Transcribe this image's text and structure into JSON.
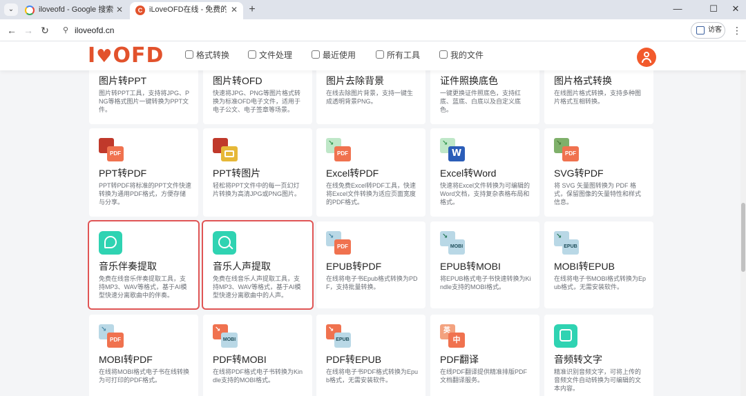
{
  "browser": {
    "tabs": [
      {
        "title": "iloveofd - Google 搜索",
        "favicon": "google-icon"
      },
      {
        "title": "iLoveOFD在线 - 免费的在线格",
        "favicon": "iloveofd-icon"
      }
    ],
    "url": "iloveofd.cn",
    "guest_label": "访客"
  },
  "header": {
    "logo": "I♥OFD",
    "nav": [
      {
        "label": "格式转换",
        "icon": "convert-icon"
      },
      {
        "label": "文件处理",
        "icon": "file-process-icon"
      },
      {
        "label": "最近使用",
        "icon": "recent-icon"
      },
      {
        "label": "所有工具",
        "icon": "all-tools-icon"
      },
      {
        "label": "我的文件",
        "icon": "my-files-icon"
      }
    ],
    "accent_color": "#e2522c"
  },
  "tools": [
    {
      "title": "图片转PPT",
      "desc": "图片转PPT工具，支持将JPG、PNG等格式图片一键转换为PPT文件。"
    },
    {
      "title": "图片转OFD",
      "desc": "快速将JPG、PNG等图片格式转换为标准OFD电子文件，适用于电子公文、电子签章等场景。"
    },
    {
      "title": "图片去除背景",
      "desc": "在线去除图片背景，支持一键生成透明背景PNG。"
    },
    {
      "title": "证件照换底色",
      "desc": "一键更换证件照底色，支持红底、蓝底、白底以及自定义底色。"
    },
    {
      "title": "图片格式转换",
      "desc": "在线图片格式转换，支持多种图片格式互相转换。"
    },
    {
      "title": "PPT转PDF",
      "desc": "PPT转PDF将标准的PPT文件快速转换为通用PDF格式，方便存储与分享。",
      "icon": {
        "from": "#c0392b",
        "to": "#f0724f",
        "to_label": "PDF",
        "arrow_color": "#c0392b"
      }
    },
    {
      "title": "PPT转图片",
      "desc": "轻松将PPT文件中的每一页幻灯片转换为高清JPG或PNG图片。",
      "icon": {
        "from": "#c0392b",
        "to": "#e6b838",
        "to_label": "",
        "arrow_color": "#c0392b"
      }
    },
    {
      "title": "Excel转PDF",
      "desc": "在线免费Excel转PDF工具，快速将Excel文件转换为适应页面宽度的PDF格式。",
      "icon": {
        "from": "#bfe7c8",
        "to": "#f0724f",
        "to_label": "PDF",
        "arrow_color": "#3a9a55"
      }
    },
    {
      "title": "Excel转Word",
      "desc": "快速将Excel文件转换为可编辑的Word文档，支持复杂表格布局和格式。",
      "icon": {
        "from": "#bfe7c8",
        "to": "#2b5db8",
        "to_label": "W",
        "arrow_color": "#3a9a55"
      }
    },
    {
      "title": "SVG转PDF",
      "desc": "将 SVG 矢量图转换为 PDF 格式，保留图像的矢量特性和样式信息。",
      "icon": {
        "from": "#7fb06a",
        "to": "#f0724f",
        "to_label": "PDF",
        "arrow_color": "#4a7a3a"
      }
    },
    {
      "title": "音乐伴奏提取",
      "desc": "免费在线音乐伴奏提取工具，支持MP3、WAV等格式，基于AI模型快速分离歌曲中的伴奏。",
      "icon": {
        "type": "guitar-icon"
      }
    },
    {
      "title": "音乐人声提取",
      "desc": "免费在线音乐人声提取工具，支持MP3、WAV等格式，基于AI模型快速分离歌曲中的人声。",
      "icon": {
        "type": "search-icon"
      }
    },
    {
      "title": "EPUB转PDF",
      "desc": "在线将电子书Epub格式转换为PDF，支持批量转换。",
      "icon": {
        "from": "#b9d8e6",
        "to": "#f0724f",
        "to_label": "PDF",
        "arrow_color": "#4a8aa8"
      }
    },
    {
      "title": "EPUB转MOBI",
      "desc": "将EPUB格式电子书快速转换为Kindle支持的MOBI格式。",
      "icon": {
        "from": "#b9d8e6",
        "to": "#b9d8e6",
        "to_label": "MOBI",
        "arrow_color": "#2a7a5a"
      }
    },
    {
      "title": "MOBI转EPUB",
      "desc": "在线将电子书MOBI格式转换为Epub格式，无需安装软件。",
      "icon": {
        "from": "#b9d8e6",
        "to": "#b9d8e6",
        "to_label": "EPUB",
        "arrow_color": "#2a7a5a"
      }
    },
    {
      "title": "MOBI转PDF",
      "desc": "在线将MOBI格式电子书在线转换为可打印的PDF格式。",
      "icon": {
        "from": "#b9d8e6",
        "to": "#f0724f",
        "to_label": "PDF",
        "arrow_color": "#4a8aa8"
      }
    },
    {
      "title": "PDF转MOBI",
      "desc": "在线将PDF格式电子书转换为Kindle支持的MOBI格式。",
      "icon": {
        "from": "#f0724f",
        "to": "#b9d8e6",
        "to_label": "MOBI",
        "arrow_color": "#ffffff"
      }
    },
    {
      "title": "PDF转EPUB",
      "desc": "在线将电子书PDF格式转换为Epub格式，无需安装软件。",
      "icon": {
        "from": "#f0724f",
        "to": "#b9d8e6",
        "to_label": "EPUB",
        "arrow_color": "#ffffff"
      }
    },
    {
      "title": "PDF翻译",
      "desc": "在线PDF翻译提供精准排版PDF文档翻译服务。",
      "icon": {
        "from": "#f3a27f",
        "to": "#f0724f",
        "to_label": "中",
        "from_label": "英",
        "arrow_color": "#ffffff"
      }
    },
    {
      "title": "音频转文字",
      "desc": "精准识别音频文字，可将上传的音频文件自动转换为可编辑的文本内容。",
      "icon": {
        "type": "audio-text-icon"
      }
    }
  ]
}
